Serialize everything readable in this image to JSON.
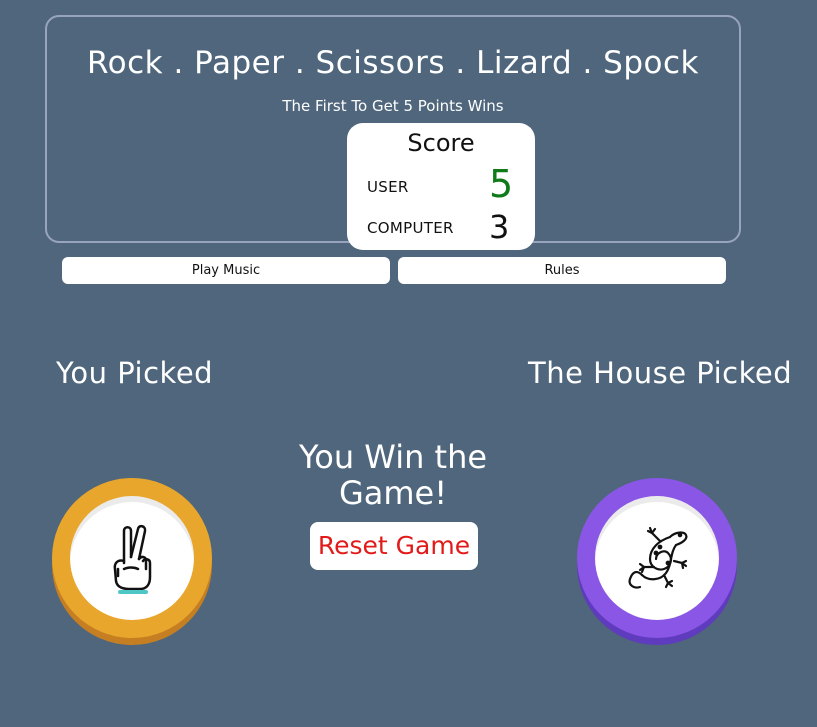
{
  "header": {
    "title": "Rock . Paper . Scissors . Lizard . Spock",
    "subtitle": "The First To Get 5 Points Wins"
  },
  "score": {
    "title": "Score",
    "user_label": "USER",
    "user_value": "5",
    "computer_label": "COMPUTER",
    "computer_value": "3"
  },
  "controls": {
    "music_button": "Play Music",
    "rules_button": "Rules"
  },
  "picks": {
    "you_label": "You Picked",
    "house_label": "The House Picked",
    "you_pick_icon": "scissors-hand-icon",
    "house_pick_icon": "lizard-icon"
  },
  "result": {
    "message": "You Win the Game!",
    "reset_button": "Reset Game"
  },
  "colors": {
    "background": "#4f667c",
    "scissors_token": "#e8a62c",
    "lizard_token": "#8a56e6",
    "user_score": "#0f7a17",
    "reset_text": "#e21a1a"
  }
}
